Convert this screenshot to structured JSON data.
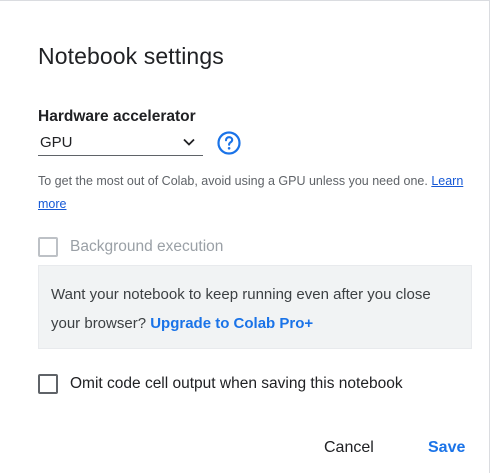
{
  "dialog": {
    "title": "Notebook settings"
  },
  "hardware": {
    "label": "Hardware accelerator",
    "selected": "GPU",
    "hint_text": "To get the most out of Colab, avoid using a GPU unless you need one.",
    "learn_more": "Learn more"
  },
  "background_execution": {
    "label": "Background execution",
    "checked": false,
    "disabled": true
  },
  "upsell": {
    "text": "Want your notebook to keep running even after you close your browser?",
    "link": "Upgrade to Colab Pro+"
  },
  "omit_output": {
    "label": "Omit code cell output when saving this notebook",
    "checked": false
  },
  "actions": {
    "cancel": "Cancel",
    "save": "Save"
  },
  "colors": {
    "accent": "#1a73e8",
    "text": "#202124",
    "muted": "#5f6368",
    "disabled": "#9aa0a6",
    "upsell_bg": "#f1f3f4"
  }
}
